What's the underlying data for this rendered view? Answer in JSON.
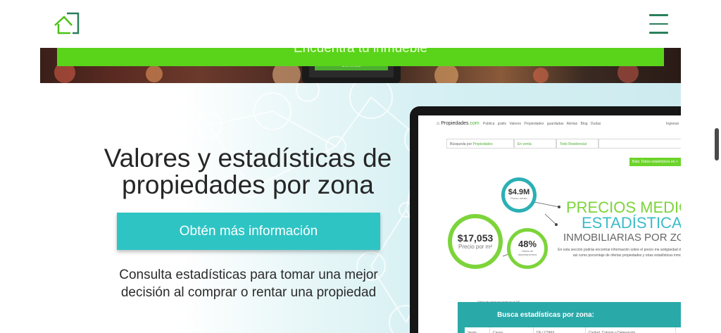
{
  "header": {
    "logo_icon": "house-logo-icon",
    "menu_icon": "hamburger-menu-icon",
    "accent_color": "#4cc21a"
  },
  "hero": {
    "cta_label": "Encuentra tu inmueble",
    "phone_button_label": "Comenzar"
  },
  "stats": {
    "title": "Valores y estadísticas de propiedades por zona",
    "button_label": "Obtén más información",
    "button_color": "#2ec4c4",
    "description": "Consulta estadísticas para tomar una mejor decisión al comprar o rentar una propiedad"
  },
  "mockup": {
    "logo_prefix": "Propiedades",
    "logo_suffix": ".com",
    "nav_links": "Publica gratis   Valores   Propiedades guardadas   Alertas   Blog   Dudas",
    "login": "Ingresar",
    "search_prefix": "Búsqueda por",
    "search_value": "Propiedades",
    "operation": "En venta",
    "category": "Todo Residencial",
    "green_button": "Bats: Datos estadísticos en +",
    "price_median_value": "$4.9M",
    "price_median_label": "Precio medio",
    "price_m2_value": "$17,053",
    "price_m2_label": "Precio por m²",
    "offer_value": "48%",
    "offer_label": "Oferta de departamentos",
    "heading_line1": "PRECIOS MEDIO",
    "heading_line2": "ESTADÍSTICAS",
    "heading_line3": "INMOBILIARIAS POR ZON",
    "paragraph": "En esta sección podrás encontrar información sobre el precio me antigüedad de las propiedades, así como porcentaje de ofertas propiedades y otras estadísticas inmobiliarias.",
    "footnote": "Datos de casas en venta en el DF",
    "panel_title": "Busca estadísticas por zona:",
    "row_venta": "Venta",
    "row_casas": "Casas",
    "row_region": "DF / CDMX",
    "row_city": "Ciudad, Colonia o Delegación",
    "search_icon": "magnifier-icon"
  }
}
